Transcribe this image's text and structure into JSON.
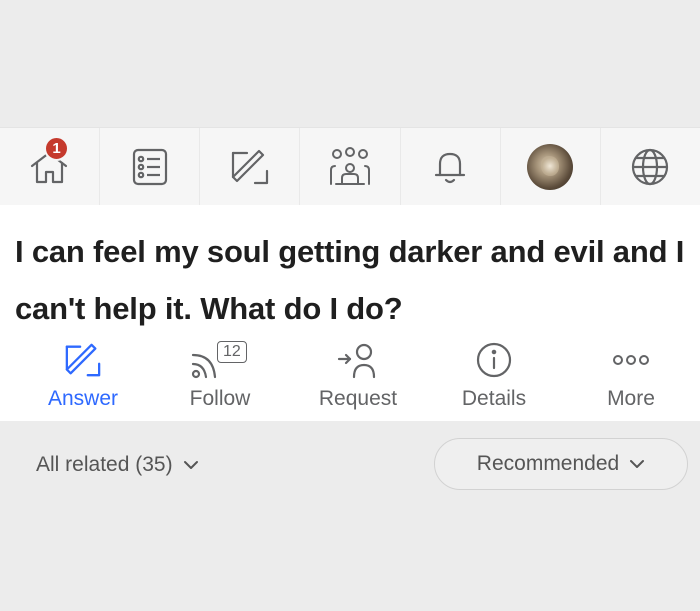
{
  "nav": {
    "home_badge": "1",
    "icons": [
      "home-icon",
      "feed-icon",
      "write-icon",
      "spaces-icon",
      "notifications-icon",
      "avatar",
      "language-icon"
    ]
  },
  "question": {
    "title": "I can feel my soul getting darker and evil and I can't help it. What do I do?"
  },
  "actions": {
    "answer_label": "Answer",
    "follow_label": "Follow",
    "follow_count": "12",
    "request_label": "Request",
    "details_label": "Details",
    "more_label": "More"
  },
  "filters": {
    "all_related": "All related (35)",
    "sort": "Recommended"
  },
  "colors": {
    "accent": "#2e69ff",
    "badge": "#c53a2d",
    "icon": "#636466"
  }
}
